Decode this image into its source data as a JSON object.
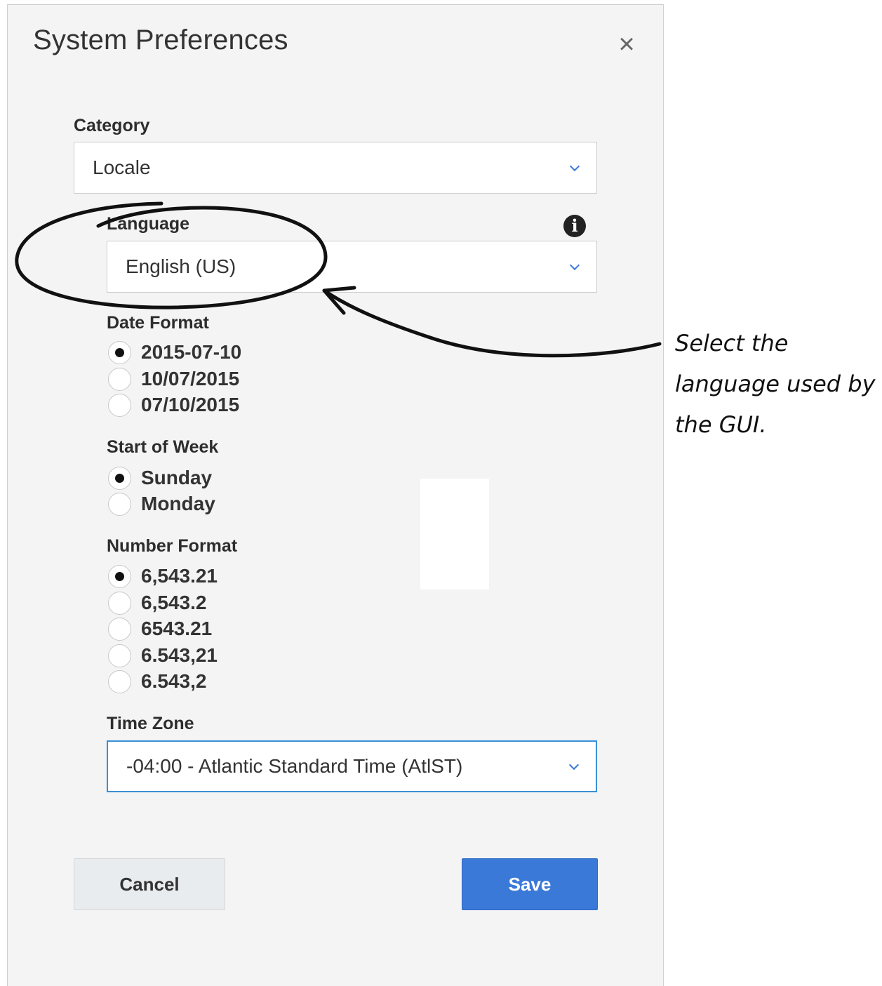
{
  "dialog": {
    "title": "System Preferences",
    "close_label": "×"
  },
  "category": {
    "label": "Category",
    "value": "Locale"
  },
  "language": {
    "label": "Language",
    "value": "English (US)",
    "info_icon": "i"
  },
  "date_format": {
    "label": "Date Format",
    "options": [
      "2015-07-10",
      "10/07/2015",
      "07/10/2015"
    ],
    "selected": "2015-07-10"
  },
  "start_of_week": {
    "label": "Start of Week",
    "options": [
      "Sunday",
      "Monday"
    ],
    "selected": "Sunday"
  },
  "number_format": {
    "label": "Number Format",
    "options": [
      "6,543.21",
      "6,543.2",
      "6543.21",
      "6.543,21",
      "6.543,2"
    ],
    "selected": "6,543.21"
  },
  "time_zone": {
    "label": "Time Zone",
    "value": "-04:00 - Atlantic Standard Time (AtlST)"
  },
  "buttons": {
    "cancel": "Cancel",
    "save": "Save"
  },
  "annotation": {
    "lines": [
      "Select the",
      "language used by",
      "the GUI."
    ]
  },
  "colors": {
    "accent": "#3b79d8",
    "dialog_bg": "#f4f4f4"
  }
}
